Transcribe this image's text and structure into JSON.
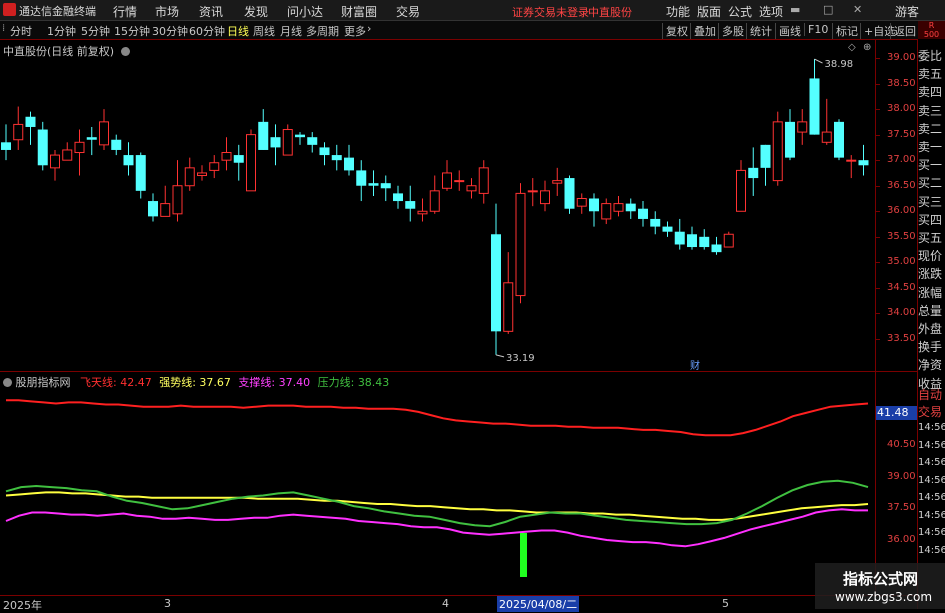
{
  "app": {
    "name": "通达信金融终端"
  },
  "menu": [
    "行情",
    "市场",
    "资讯",
    "发现",
    "问小达",
    "财富圈",
    "交易"
  ],
  "alert": {
    "login": "证券交易未登录",
    "stock": "中直股份"
  },
  "right_menu": [
    "功能",
    "版面",
    "公式",
    "选项"
  ],
  "guest": "游客",
  "periods": [
    "分时",
    "1分钟",
    "5分钟",
    "15分钟",
    "30分钟",
    "60分钟",
    "日线",
    "周线",
    "月线",
    "多周期",
    "更多"
  ],
  "active_period": "日线",
  "toolbar_right": [
    "复权",
    "叠加",
    "多股",
    "统计",
    "画线",
    "F10",
    "标记",
    "+自选",
    "返回"
  ],
  "main_chart": {
    "title": "中直股份(日线 前复权)",
    "high_label": "38.98",
    "low_label": "33.19",
    "event_marker": "财",
    "yticks": [
      "39.00",
      "38.50",
      "38.00",
      "37.50",
      "37.00",
      "36.50",
      "36.00",
      "35.50",
      "35.00",
      "34.50",
      "34.00",
      "33.50"
    ]
  },
  "indicator": {
    "name": "股朋指标网",
    "lines": [
      {
        "name": "飞天线",
        "value": "42.47",
        "color": "#ff3030"
      },
      {
        "name": "强势线",
        "value": "37.67",
        "color": "#ffff60"
      },
      {
        "name": "支撑线",
        "value": "37.40",
        "color": "#ff40ff"
      },
      {
        "name": "压力线",
        "value": "38.43",
        "color": "#40c040"
      }
    ],
    "yticks": [
      "40.50",
      "39.00",
      "37.50",
      "36.00"
    ],
    "current_value": "41.48"
  },
  "date_axis": {
    "labels": [
      {
        "text": "2025年",
        "highlight": false
      },
      {
        "text": "3",
        "highlight": false
      },
      {
        "text": "4",
        "highlight": false
      },
      {
        "text": "2025/04/08/二",
        "highlight": true
      },
      {
        "text": "5",
        "highlight": false
      }
    ]
  },
  "side_panel": [
    "委比",
    "卖五",
    "卖四",
    "卖三",
    "卖二",
    "卖一",
    "买一",
    "买二",
    "买三",
    "买四",
    "买五",
    "现价",
    "涨跌",
    "涨幅",
    "总量",
    "外盘",
    "换手",
    "净资",
    "收益"
  ],
  "side_panel_lower": [
    "自动",
    "交易"
  ],
  "side_times": [
    "14:56",
    "14:56",
    "14:56",
    "14:56",
    "14:56",
    "14:56",
    "14:56",
    "14:56"
  ],
  "side_top": [
    "R",
    "500"
  ],
  "watermark": {
    "title": "指标公式网",
    "url": "www.zbgs3.com"
  },
  "chart_data": {
    "type": "candlestick",
    "candles": [
      [
        37.35,
        37.2,
        37.7,
        37.0
      ],
      [
        37.4,
        37.7,
        38.05,
        37.2
      ],
      [
        37.85,
        37.65,
        37.95,
        37.3
      ],
      [
        37.6,
        36.9,
        37.75,
        36.8
      ],
      [
        36.85,
        37.1,
        37.2,
        36.6
      ],
      [
        37.0,
        37.2,
        37.35,
        37.0
      ],
      [
        37.15,
        37.35,
        37.6,
        36.7
      ],
      [
        37.45,
        37.4,
        37.65,
        37.1
      ],
      [
        37.3,
        37.75,
        38.0,
        37.2
      ],
      [
        37.4,
        37.2,
        37.5,
        37.1
      ],
      [
        37.1,
        36.9,
        37.35,
        36.7
      ],
      [
        37.1,
        36.4,
        37.15,
        36.25
      ],
      [
        36.2,
        35.9,
        36.35,
        35.8
      ],
      [
        35.9,
        36.15,
        36.5,
        35.95
      ],
      [
        35.95,
        36.5,
        37.0,
        35.8
      ],
      [
        36.5,
        36.85,
        37.05,
        36.4
      ],
      [
        36.7,
        36.75,
        36.9,
        36.6
      ],
      [
        36.8,
        36.95,
        37.1,
        36.65
      ],
      [
        37.0,
        37.15,
        37.45,
        36.8
      ],
      [
        37.1,
        36.95,
        37.3,
        36.6
      ],
      [
        36.4,
        37.5,
        37.6,
        36.4
      ],
      [
        37.75,
        37.2,
        38.0,
        37.2
      ],
      [
        37.45,
        37.25,
        37.7,
        36.9
      ],
      [
        37.1,
        37.6,
        37.7,
        37.1
      ],
      [
        37.5,
        37.45,
        37.55,
        37.3
      ],
      [
        37.45,
        37.3,
        37.55,
        37.15
      ],
      [
        37.25,
        37.1,
        37.35,
        36.9
      ],
      [
        37.1,
        37.0,
        37.3,
        36.8
      ],
      [
        37.05,
        36.8,
        37.3,
        36.7
      ],
      [
        36.8,
        36.5,
        37.0,
        36.2
      ],
      [
        36.55,
        36.5,
        36.8,
        36.3
      ],
      [
        36.55,
        36.45,
        36.7,
        36.2
      ],
      [
        36.35,
        36.2,
        36.5,
        36.05
      ],
      [
        36.2,
        36.05,
        36.5,
        35.8
      ],
      [
        35.95,
        36.0,
        36.25,
        35.8
      ],
      [
        36.0,
        36.4,
        36.7,
        35.95
      ],
      [
        36.45,
        36.75,
        37.0,
        36.4
      ],
      [
        36.6,
        36.6,
        36.8,
        36.4
      ],
      [
        36.4,
        36.5,
        36.65,
        36.25
      ],
      [
        36.35,
        36.85,
        37.0,
        36.15
      ],
      [
        35.55,
        33.65,
        36.15,
        33.19
      ],
      [
        33.65,
        34.6,
        35.2,
        33.6
      ],
      [
        34.35,
        36.35,
        36.55,
        34.2
      ],
      [
        36.4,
        36.4,
        36.65,
        36.1
      ],
      [
        36.15,
        36.4,
        36.6,
        36.0
      ],
      [
        36.55,
        36.6,
        36.85,
        36.3
      ],
      [
        36.65,
        36.05,
        36.7,
        35.95
      ],
      [
        36.1,
        36.25,
        36.35,
        35.95
      ],
      [
        36.25,
        36.0,
        36.35,
        35.7
      ],
      [
        35.85,
        36.15,
        36.25,
        35.75
      ],
      [
        36.0,
        36.15,
        36.3,
        35.9
      ],
      [
        36.15,
        36.0,
        36.25,
        35.85
      ],
      [
        36.05,
        35.85,
        36.2,
        35.7
      ],
      [
        35.85,
        35.7,
        36.0,
        35.55
      ],
      [
        35.7,
        35.6,
        35.8,
        35.5
      ],
      [
        35.6,
        35.35,
        35.85,
        35.25
      ],
      [
        35.55,
        35.3,
        35.7,
        35.25
      ],
      [
        35.5,
        35.3,
        35.65,
        35.25
      ],
      [
        35.35,
        35.2,
        35.5,
        35.15
      ],
      [
        35.3,
        35.55,
        35.6,
        35.3
      ],
      [
        36.0,
        36.8,
        37.0,
        36.0
      ],
      [
        36.85,
        36.65,
        37.25,
        36.3
      ],
      [
        37.3,
        36.85,
        37.3,
        36.5
      ],
      [
        36.6,
        37.75,
        37.95,
        36.5
      ],
      [
        37.75,
        37.05,
        38.0,
        37.0
      ],
      [
        37.55,
        37.75,
        38.0,
        37.3
      ],
      [
        38.6,
        37.5,
        38.98,
        37.5
      ],
      [
        37.35,
        37.55,
        38.2,
        37.3
      ],
      [
        37.75,
        37.05,
        37.8,
        37.0
      ],
      [
        37.0,
        37.0,
        37.1,
        36.65
      ],
      [
        37.0,
        36.9,
        37.3,
        36.7
      ]
    ],
    "ylim": [
      33.2,
      39.25
    ],
    "indicator_ylim": [
      35.2,
      43.0
    ],
    "series": [
      {
        "name": "飞天线",
        "color": "#ff2020",
        "values": [
          42.6,
          42.6,
          42.55,
          42.5,
          42.45,
          42.5,
          42.5,
          42.45,
          42.4,
          42.4,
          42.35,
          42.3,
          42.3,
          42.3,
          42.35,
          42.3,
          42.3,
          42.3,
          42.3,
          42.25,
          42.3,
          42.35,
          42.35,
          42.35,
          42.3,
          42.3,
          42.3,
          42.25,
          42.25,
          42.2,
          42.2,
          42.2,
          42.15,
          42.05,
          41.9,
          41.75,
          41.65,
          41.6,
          41.55,
          41.5,
          41.5,
          41.45,
          41.4,
          41.4,
          41.4,
          41.35,
          41.35,
          41.3,
          41.3,
          41.3,
          41.25,
          41.2,
          41.2,
          41.15,
          41.1,
          41.0,
          40.95,
          40.95,
          40.95,
          41.05,
          41.2,
          41.4,
          41.6,
          41.85,
          42.0,
          42.15,
          42.3,
          42.35,
          42.4,
          42.45
        ]
      },
      {
        "name": "强势线",
        "color": "#ffff40",
        "values": [
          38.1,
          38.15,
          38.2,
          38.25,
          38.25,
          38.2,
          38.2,
          38.15,
          38.1,
          38.05,
          38.05,
          38.0,
          38.0,
          38.0,
          38.0,
          38.0,
          38.0,
          38.0,
          38.0,
          37.95,
          37.95,
          37.95,
          37.95,
          37.9,
          37.85,
          37.85,
          37.8,
          37.75,
          37.7,
          37.7,
          37.65,
          37.6,
          37.6,
          37.55,
          37.5,
          37.45,
          37.45,
          37.4,
          37.4,
          37.35,
          37.3,
          37.3,
          37.3,
          37.3,
          37.25,
          37.25,
          37.2,
          37.2,
          37.15,
          37.1,
          37.05,
          37.0,
          37.0,
          36.95,
          36.95,
          37.0,
          37.1,
          37.2,
          37.3,
          37.4,
          37.5,
          37.55,
          37.6,
          37.65,
          37.65,
          37.7
        ]
      },
      {
        "name": "支撑线",
        "color": "#ff30ff",
        "values": [
          36.9,
          37.15,
          37.3,
          37.3,
          37.25,
          37.2,
          37.2,
          37.15,
          37.2,
          37.25,
          37.15,
          37.1,
          37.0,
          37.0,
          37.05,
          37.0,
          36.95,
          36.95,
          37.0,
          37.05,
          37.05,
          37.15,
          37.2,
          37.15,
          37.1,
          37.05,
          37.0,
          36.9,
          36.85,
          36.8,
          36.75,
          36.65,
          36.6,
          36.6,
          36.5,
          36.35,
          36.3,
          36.25,
          36.3,
          36.35,
          36.4,
          36.45,
          36.45,
          36.35,
          36.2,
          36.1,
          36.0,
          35.95,
          35.9,
          35.9,
          35.85,
          35.75,
          35.7,
          35.8,
          35.95,
          36.1,
          36.3,
          36.5,
          36.65,
          36.8,
          36.95,
          37.1,
          37.3,
          37.4,
          37.45,
          37.4,
          37.4
        ]
      },
      {
        "name": "压力线",
        "color": "#40c040",
        "values": [
          38.3,
          38.5,
          38.55,
          38.5,
          38.45,
          38.35,
          38.3,
          38.05,
          37.85,
          37.75,
          37.6,
          37.45,
          37.5,
          37.65,
          37.8,
          37.95,
          38.05,
          38.1,
          38.2,
          38.25,
          38.1,
          37.95,
          37.8,
          37.6,
          37.5,
          37.35,
          37.25,
          37.15,
          37.1,
          36.95,
          36.8,
          36.7,
          36.65,
          36.85,
          37.1,
          37.2,
          37.3,
          37.25,
          37.25,
          37.15,
          37.05,
          36.95,
          36.9,
          36.85,
          36.8,
          36.75,
          36.75,
          36.8,
          36.95,
          37.25,
          37.6,
          38.0,
          38.35,
          38.6,
          38.75,
          38.8,
          38.7,
          38.5
        ]
      }
    ],
    "volume_signal": {
      "index": 40,
      "color": "#20ff20"
    }
  }
}
